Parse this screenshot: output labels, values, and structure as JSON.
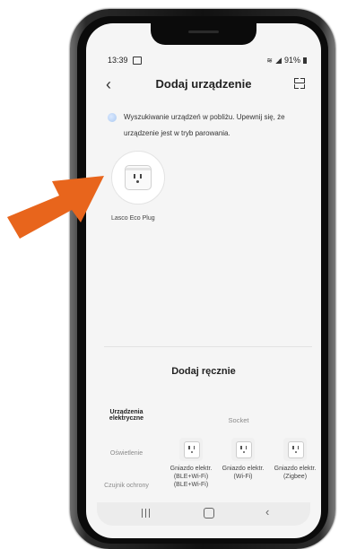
{
  "status": {
    "time": "13:39",
    "battery": "91%"
  },
  "header": {
    "title": "Dodaj urządzenie"
  },
  "search": {
    "text": "Wyszukiwanie urządzeń w pobliżu. Upewnij się, że urządzenie jest w tryb parowania."
  },
  "found_device": {
    "name": "Lasco Eco Plug"
  },
  "manual": {
    "title": "Dodaj ręcznie"
  },
  "categories": [
    {
      "label": "Urządzenia elektryczne",
      "active": true
    },
    {
      "label": "Oświetlenie",
      "active": false
    },
    {
      "label": "Czujnik ochrony",
      "active": false
    }
  ],
  "socket_header": "Socket",
  "socket_items": [
    {
      "label": "Gniazdo elektr. (BLE+Wi-Fi) (BLE+Wi-Fi)"
    },
    {
      "label": "Gniazdo elektr. (Wi-Fi)"
    },
    {
      "label": "Gniazdo elektr. (Zigbee)"
    }
  ],
  "colors": {
    "arrow": "#e8651c",
    "background": "#f5f5f5"
  }
}
